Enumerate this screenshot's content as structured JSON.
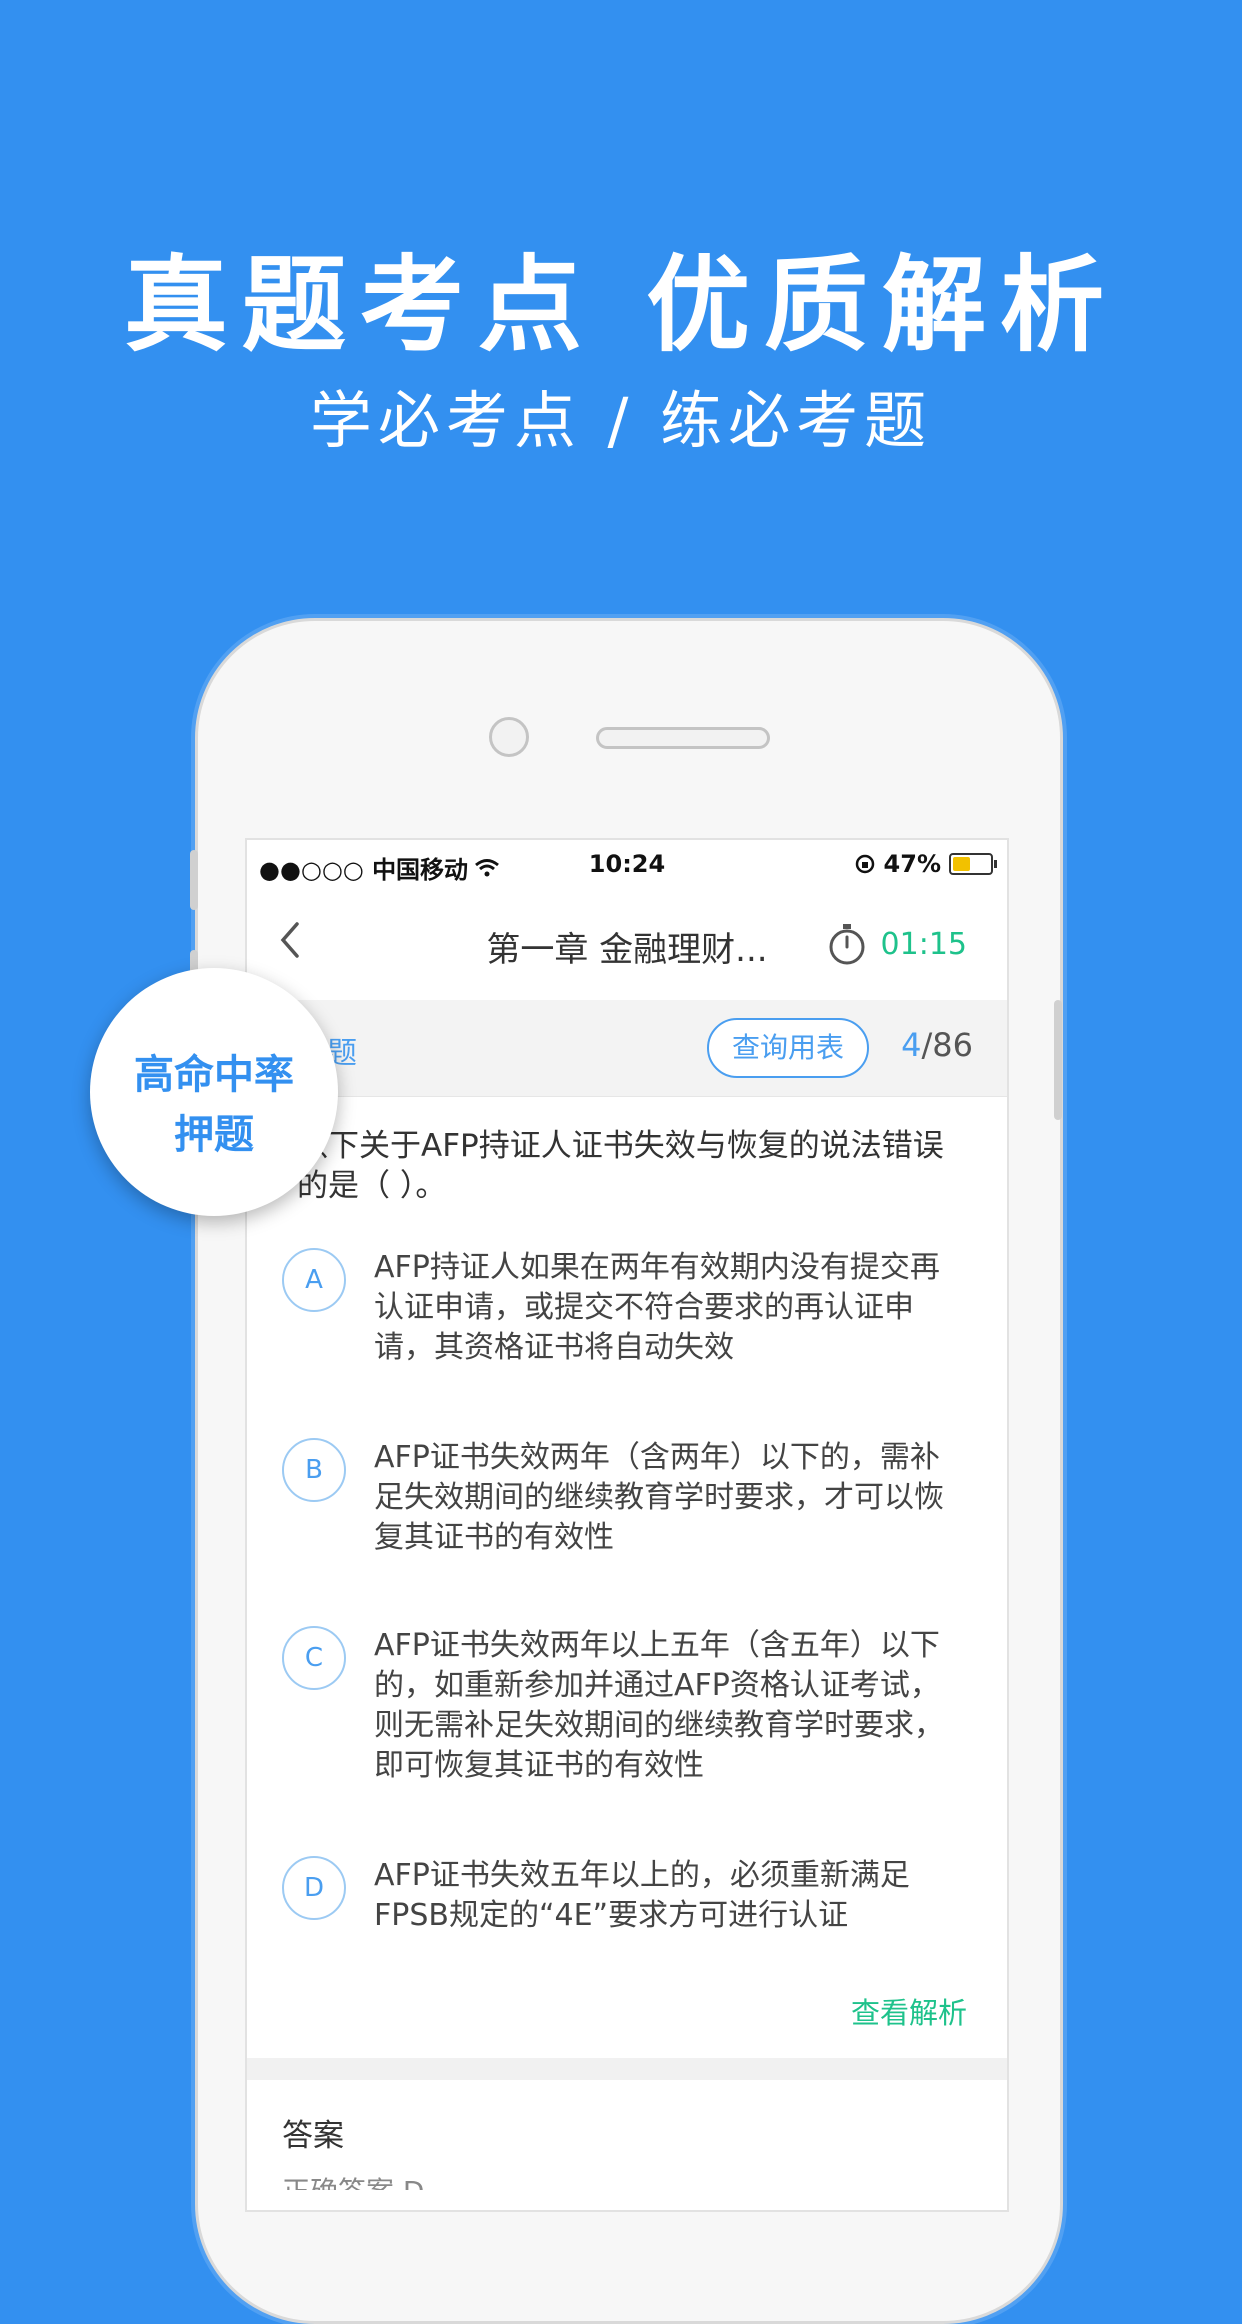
{
  "hero": {
    "headline": "真题考点 优质解析",
    "subheadline": "学必考点 / 练必考题"
  },
  "badge": {
    "line1": "高命中率",
    "line2": "押题"
  },
  "status_bar": {
    "carrier": "●●○○○ 中国移动",
    "time": "10:24",
    "battery": "47%",
    "battery_level": 0.47
  },
  "nav": {
    "back_glyph": "‹",
    "title": "第一章 金融理财...",
    "timer": "01:15"
  },
  "question_bar": {
    "type": "选题",
    "lookup_button": "查询用表",
    "current": "4",
    "total": "/86"
  },
  "question": {
    "stem": "以下关于AFP持证人证书失效与恢复的说法错误的是（ ）。"
  },
  "options": [
    {
      "letter": "A",
      "text": "AFP持证人如果在两年有效期内没有提交再认证申请，或提交不符合要求的再认证申请，其资格证书将自动失效"
    },
    {
      "letter": "B",
      "text": "AFP证书失效两年（含两年）以下的，需补足失效期间的继续教育学时要求，才可以恢复其证书的有效性"
    },
    {
      "letter": "C",
      "text": "AFP证书失效两年以上五年（含五年）以下的，如重新参加并通过AFP资格认证考试，则无需补足失效期间的继续教育学时要求，即可恢复其证书的有效性"
    },
    {
      "letter": "D",
      "text": "AFP证书失效五年以上的，必须重新满足FPSB规定的“4E”要求方可进行认证"
    }
  ],
  "analysis_link": "查看解析",
  "answer": {
    "label": "答案",
    "sub": "正确答案 D"
  },
  "colors": {
    "background": "#3390f0",
    "accent_blue": "#4a9ef0",
    "accent_green": "#1ec28b"
  }
}
